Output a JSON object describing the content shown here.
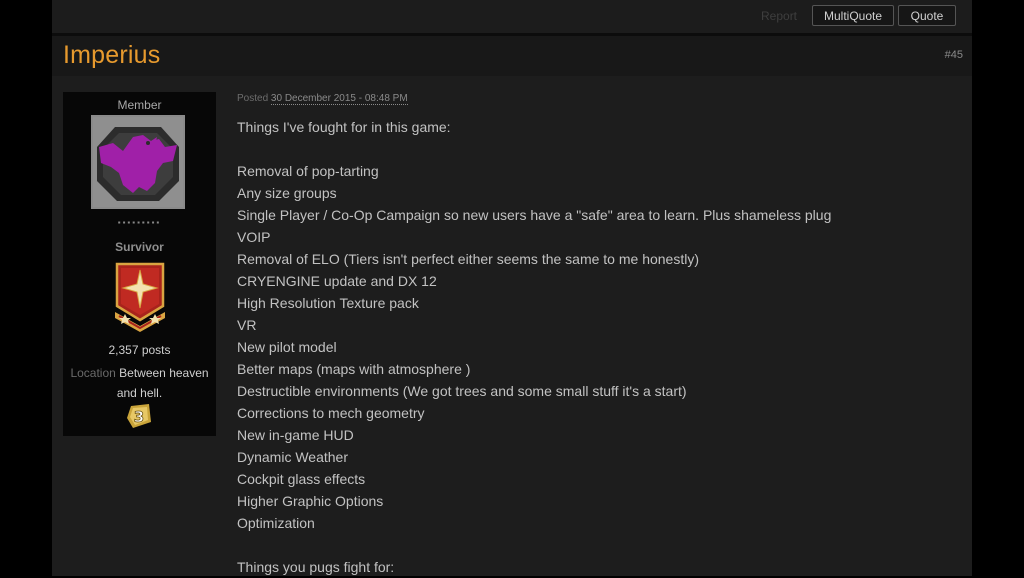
{
  "toolbar": {
    "report_label": "Report",
    "multiquote_label": "MultiQuote",
    "quote_label": "Quote"
  },
  "post": {
    "author": "Imperius",
    "number": "#45",
    "posted_prefix": "Posted",
    "posted_date": "30 December 2015 - 08:48 PM",
    "lines": [
      "Things I've fought for in this game:",
      "",
      "Removal of pop-tarting",
      "Any size groups",
      "Single Player / Co-Op Campaign so new users have a \"safe\" area to learn. Plus shameless plug",
      "VOIP",
      "Removal of ELO (Tiers isn't perfect either seems the same to me honestly)",
      "CRYENGINE update and DX 12",
      "High Resolution Texture pack",
      "VR",
      "New pilot model",
      "Better maps (maps with atmosphere )",
      "Destructible environments (We got trees and some small stuff it's a start)",
      "Corrections to mech geometry",
      "New in-game HUD",
      "Dynamic Weather",
      "Cockpit glass effects",
      "Higher Graphic Options",
      "Optimization",
      "",
      "Things you pugs fight for:"
    ]
  },
  "author_panel": {
    "group": "Member",
    "pips": "▪▪▪▪▪▪▪▪▪",
    "rank_title": "Survivor",
    "post_count": "2,357 posts",
    "location_label": "Location",
    "location_value": "Between heaven and hell.",
    "level_badge": "3"
  },
  "icons": {
    "avatar": "purple-eagle-avatar",
    "rank_badge": "star-shield-rank-icon",
    "level_badge": "gold-level-3-icon"
  },
  "colors": {
    "author_name": "#e79a2e",
    "avatar_eagle": "#a020a8",
    "background": "#1d1d1d"
  }
}
